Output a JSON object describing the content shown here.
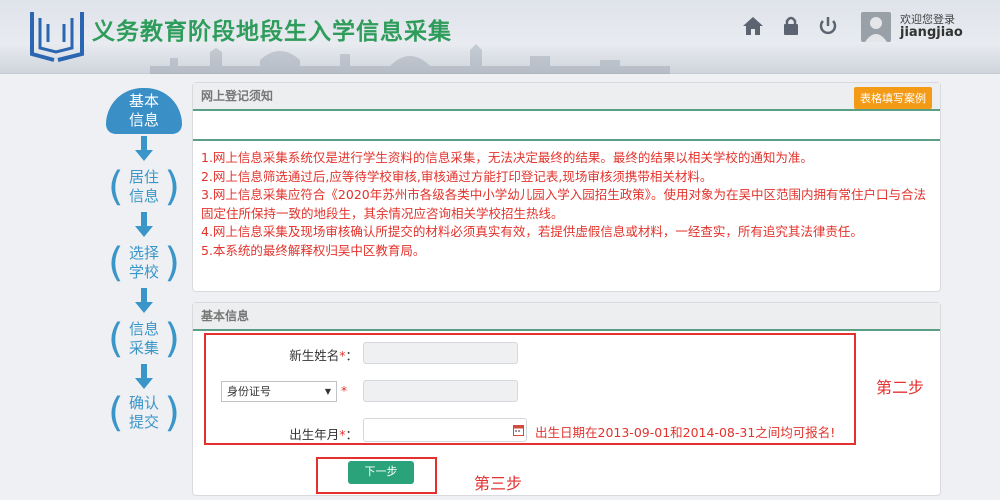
{
  "header": {
    "title": "义务教育阶段地段生入学信息采集",
    "welcome": "欢迎您登录",
    "username": "jiangjiao",
    "icons": [
      "home-icon",
      "lock-icon",
      "power-icon"
    ]
  },
  "steps": [
    {
      "label": "基本\n信息",
      "line1": "基本",
      "line2": "信息",
      "active": true
    },
    {
      "line1": "居住",
      "line2": "信息",
      "active": false
    },
    {
      "line1": "选择",
      "line2": "学校",
      "active": false
    },
    {
      "line1": "信息",
      "line2": "采集",
      "active": false
    },
    {
      "line1": "确认",
      "line2": "提交",
      "active": false
    }
  ],
  "notice_panel": {
    "heading": "网上登记须知",
    "example_button": "表格填写案例",
    "lines": [
      "1.网上信息采集系统仅是进行学生资料的信息采集，无法决定最终的结果。最终的结果以相关学校的通知为准。",
      "2.网上信息筛选通过后,应等待学校审核,审核通过方能打印登记表,现场审核须携带相关材料。",
      "3.网上信息采集应符合《2020年苏州市各级各类中小学幼儿园入学入园招生政策》。使用对象为在吴中区范围内拥有常住户口与合法",
      "固定住所保持一致的地段生，其余情况应咨询相关学校招生热线。",
      "4.网上信息采集及现场审核确认所提交的材料必须真实有效，若提供虚假信息或材料，一经查实，所有追究其法律责任。",
      "5.本系统的最终解释权归吴中区教育局。"
    ]
  },
  "form_panel": {
    "heading": "基本信息",
    "name_label": "新生姓名",
    "id_type_selected": "身份证号",
    "birth_label": "出生年月",
    "colon": "：",
    "required_mark": "*",
    "birth_hint": "出生日期在2013-09-01和2014-08-31之间均可报名!",
    "next_button": "下一步"
  },
  "annotations": {
    "step2": "第二步",
    "step3": "第三步"
  },
  "colors": {
    "title_green": "#2e9c5a",
    "step_blue": "#3a8fc7",
    "notice_red": "#e2332c",
    "orange": "#f39a17",
    "next_green": "#2aa27a",
    "annotation_red": "#e53030"
  }
}
